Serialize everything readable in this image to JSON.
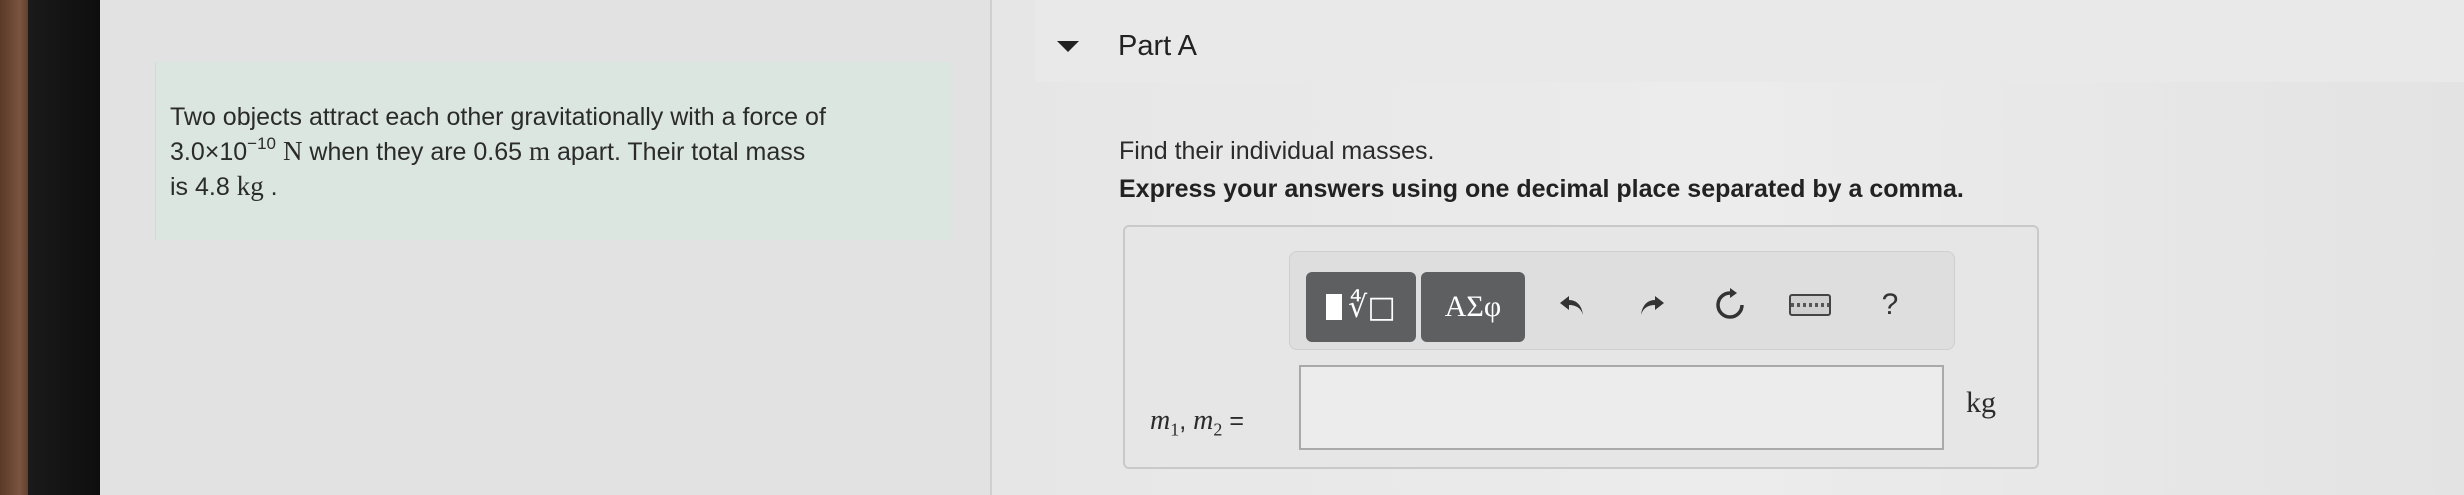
{
  "problem": {
    "line1": "Two objects attract each other gravitationally with a force of",
    "force_mantissa": "3.0×10",
    "force_exponent": "−10",
    "force_unit": "N",
    "line2_rest": " when they are 0.65 ",
    "distance_unit": "m",
    "line2_end": " apart. Their total mass",
    "line3_start": "is 4.8 ",
    "mass_unit": "kg",
    "line3_end": " ."
  },
  "part": {
    "title": "Part A",
    "instruction": "Find their individual masses.",
    "format_note": "Express your answers using one decimal place separated by a comma."
  },
  "toolbar": {
    "templates_icon": "template-radical-icon",
    "symbols_label": "ΑΣφ",
    "undo_icon": "undo-icon",
    "redo_icon": "redo-icon",
    "reset_icon": "reset-icon",
    "keyboard_icon": "keyboard-icon",
    "help_label": "?"
  },
  "answer": {
    "var1": "m",
    "sub1": "1",
    "var2": "m",
    "sub2": "2",
    "equals": " =",
    "value": "",
    "unit": "kg"
  },
  "colors": {
    "problem_bg": "#dbe6e1",
    "toolbar_button": "#5d5f61"
  }
}
